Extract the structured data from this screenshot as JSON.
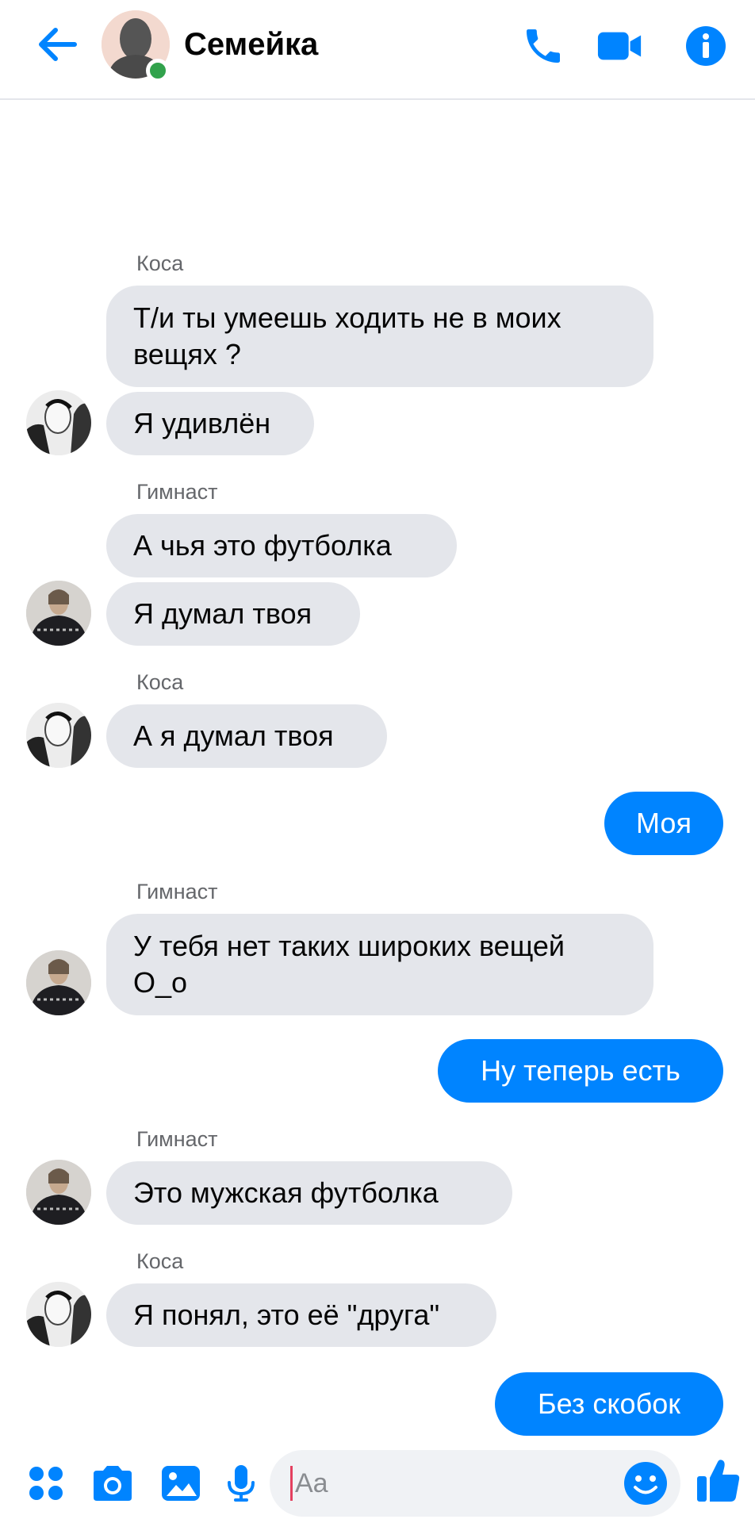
{
  "header": {
    "title": "Семейка",
    "back_icon": "arrow-left-icon",
    "call_icon": "phone-icon",
    "video_icon": "video-camera-icon",
    "info_icon": "info-icon",
    "online": true
  },
  "colors": {
    "accent": "#0084ff",
    "incoming_bubble": "#e4e6eb",
    "online": "#31a24c",
    "sender_name": "#65676b"
  },
  "messages": [
    {
      "sender": "Коса"
    },
    {
      "text": "Т/и ты умеешь ходить не в моих\nвещях ?"
    },
    {
      "text": "Я удивлён"
    },
    {
      "sender": "Гимнаст"
    },
    {
      "text": "А чья это футболка"
    },
    {
      "text": "Я думал твоя"
    },
    {
      "sender": "Коса"
    },
    {
      "text": "А я думал твоя"
    },
    {
      "text": "Моя"
    },
    {
      "sender": "Гимнаст"
    },
    {
      "text": "У тебя нет таких широких вещей\nО_о"
    },
    {
      "text": "Ну теперь есть"
    },
    {
      "sender": "Гимнаст"
    },
    {
      "text": "Это мужская футболка"
    },
    {
      "sender": "Коса"
    },
    {
      "text": "Я понял, это её \"друга\""
    },
    {
      "text": "Без скобок"
    }
  ],
  "composer": {
    "placeholder": "Aa",
    "icons": [
      "apps-icon",
      "camera-icon",
      "gallery-icon",
      "microphone-icon",
      "emoji-icon",
      "thumbs-up-icon"
    ]
  }
}
